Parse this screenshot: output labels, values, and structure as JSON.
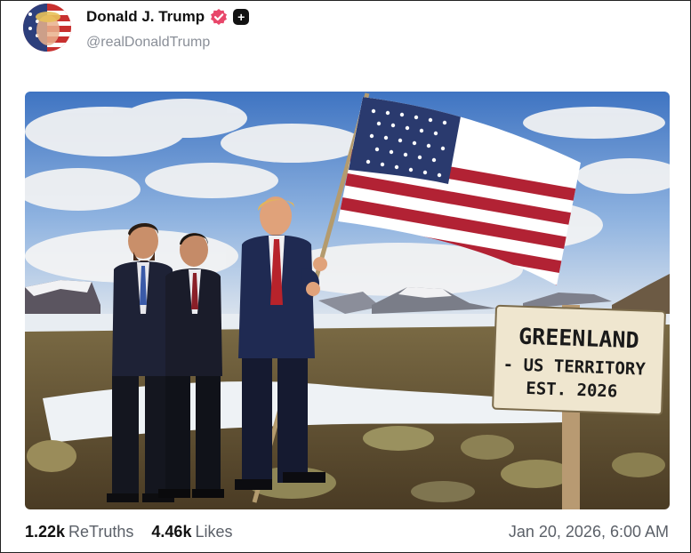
{
  "post": {
    "author_name": "Donald J. Trump",
    "handle": "@realDonaldTrump",
    "badges": [
      "verified-icon",
      "plus-icon"
    ],
    "plus_glyph": "+",
    "image": {
      "sign_line1": "GREENLAND",
      "sign_line2": "- US TERRITORY",
      "sign_line3": "EST. 2026"
    }
  },
  "footer": {
    "retruths_count": "1.22k",
    "retruths_label": "ReTruths",
    "likes_count": "4.46k",
    "likes_label": "Likes",
    "timestamp": "Jan 20, 2026, 6:00 AM"
  },
  "colors": {
    "verified_badge": "#e8476a",
    "handle_gray": "#8a8f98",
    "sky_blue": "#4d7fc7",
    "flag_red": "#b22234",
    "flag_blue": "#2a3a6e"
  }
}
